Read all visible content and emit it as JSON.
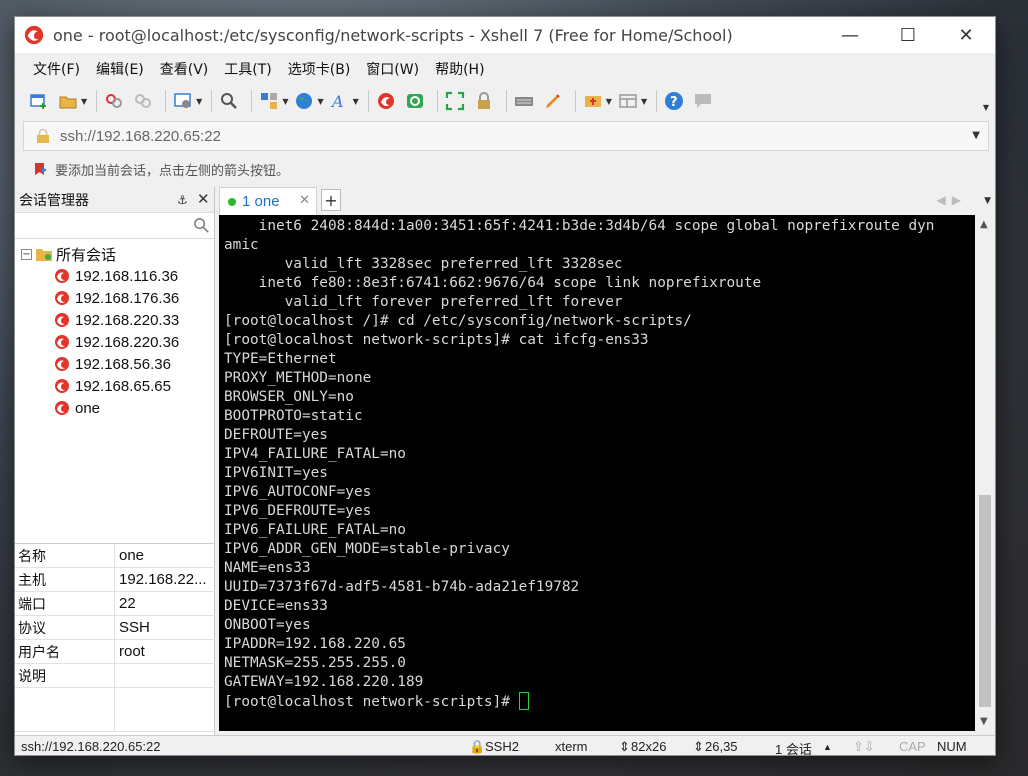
{
  "window": {
    "title": "one - root@localhost:/etc/sysconfig/network-scripts - Xshell 7 (Free for Home/School)",
    "controls": {
      "minimize": "—",
      "maximize": "☐",
      "close": "✕"
    }
  },
  "menu": [
    "文件(F)",
    "编辑(E)",
    "查看(V)",
    "工具(T)",
    "选项卡(B)",
    "窗口(W)",
    "帮助(H)"
  ],
  "toolbar": {
    "icons": [
      "new-session-icon",
      "open-folder-icon",
      "reconnect-icon",
      "disconnect-icon",
      "properties-icon",
      "find-icon",
      "transfer-icon",
      "globe-icon",
      "font-icon",
      "xshell-icon",
      "xftp-icon",
      "fullscreen-icon",
      "lock-icon",
      "keyboard-icon",
      "highlight-icon",
      "compose-icon",
      "layout-icon",
      "help-icon",
      "chat-icon"
    ]
  },
  "address": {
    "value": "ssh://192.168.220.65:22"
  },
  "hint": {
    "text": "要添加当前会话，点击左侧的箭头按钮。"
  },
  "session_manager": {
    "title": "会话管理器",
    "pin": "📌",
    "close": "✕",
    "root_label": "所有会话",
    "sessions": [
      "192.168.116.36",
      "192.168.176.36",
      "192.168.220.33",
      "192.168.220.36",
      "192.168.56.36",
      "192.168.65.65",
      "one"
    ],
    "properties": [
      {
        "key": "名称",
        "value": "one"
      },
      {
        "key": "主机",
        "value": "192.168.22..."
      },
      {
        "key": "端口",
        "value": "22"
      },
      {
        "key": "协议",
        "value": "SSH"
      },
      {
        "key": "用户名",
        "value": "root"
      },
      {
        "key": "说明",
        "value": ""
      }
    ]
  },
  "tabs": [
    {
      "label": "1 one",
      "active": true
    }
  ],
  "terminal": {
    "lines": [
      "    inet6 2408:844d:1a00:3451:65f:4241:b3de:3d4b/64 scope global noprefixroute dyn",
      "amic",
      "       valid_lft 3328sec preferred_lft 3328sec",
      "    inet6 fe80::8e3f:6741:662:9676/64 scope link noprefixroute",
      "       valid_lft forever preferred_lft forever",
      "[root@localhost /]# cd /etc/sysconfig/network-scripts/",
      "[root@localhost network-scripts]# cat ifcfg-ens33",
      "TYPE=Ethernet",
      "PROXY_METHOD=none",
      "BROWSER_ONLY=no",
      "BOOTPROTO=static",
      "DEFROUTE=yes",
      "IPV4_FAILURE_FATAL=no",
      "IPV6INIT=yes",
      "IPV6_AUTOCONF=yes",
      "IPV6_DEFROUTE=yes",
      "IPV6_FAILURE_FATAL=no",
      "IPV6_ADDR_GEN_MODE=stable-privacy",
      "NAME=ens33",
      "UUID=7373f67d-adf5-4581-b74b-ada21ef19782",
      "DEVICE=ens33",
      "ONBOOT=yes",
      "IPADDR=192.168.220.65",
      "NETMASK=255.255.255.0",
      "GATEWAY=192.168.220.189"
    ],
    "prompt": "[root@localhost network-scripts]# ",
    "colors": {
      "background": "#000000",
      "foreground": "#d8d8d8",
      "cursor": "#2fcf2f"
    }
  },
  "status": {
    "connection": "ssh://192.168.220.65:22",
    "protocol": "SSH2",
    "terminal_type": "xterm",
    "size": "82x26",
    "cursor_pos": "26,35",
    "sessions": "1 会话",
    "cap": "CAP",
    "num": "NUM"
  }
}
